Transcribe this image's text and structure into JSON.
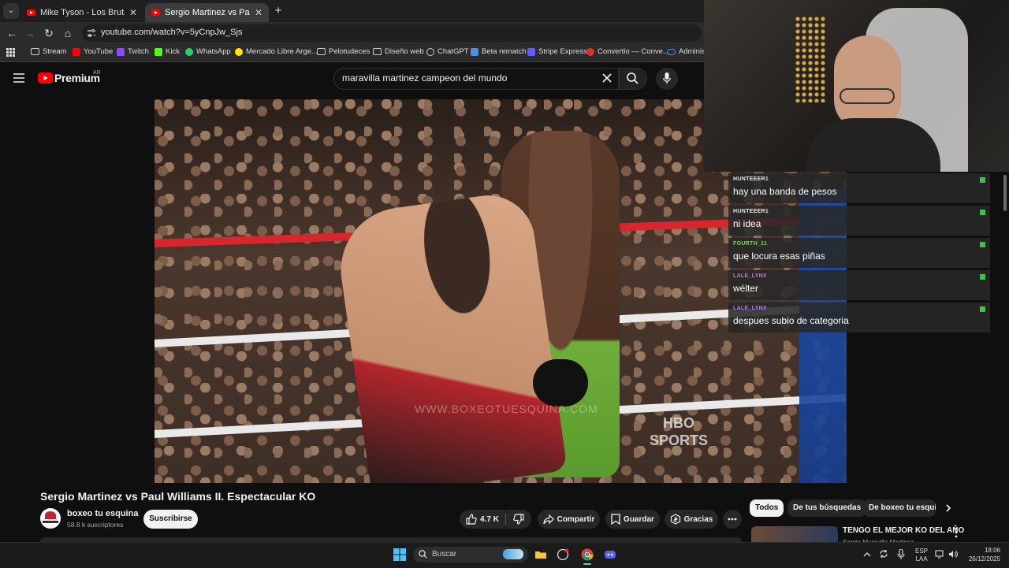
{
  "browser": {
    "tabs": [
      {
        "title": "Mike Tyson - Los Brutales Noca"
      },
      {
        "title": "Sergio Martinez vs Paul William"
      }
    ],
    "url": "youtube.com/watch?v=5yCnpJw_Sjs",
    "bookmarks": [
      "Stream",
      "YouTube",
      "Twitch",
      "Kick",
      "WhatsApp",
      "Mercado Libre Arge...",
      "Pelotudeces",
      "Diseño web",
      "ChatGPT",
      "Beta rematch",
      "Stripe Express",
      "Convertio — Conve...",
      "Administ"
    ]
  },
  "youtube": {
    "logo_text": "Premium",
    "logo_region": "AR",
    "search_query": "maravilla martinez campeon del mundo"
  },
  "video": {
    "watermark": "WWW.BOXEOTUESQUINA.COM",
    "network_logo": "HBO SPORTS",
    "title": "Sergio Martinez vs Paul Williams II. Espectacular KO",
    "channel": "boxeo tu esquina",
    "subscribers": "58.8 k suscriptores",
    "subscribe_label": "Suscribirse",
    "likes": "4.7 K",
    "share_label": "Compartir",
    "save_label": "Guardar",
    "thanks_label": "Gracias"
  },
  "chips": [
    "Todos",
    "De tus búsquedas",
    "De boxeo tu esquina"
  ],
  "recommendation": {
    "title": "TENGO EL MEJOR KO DEL AÑO",
    "channel": "Sergio Maravilla Martinez"
  },
  "chat": [
    {
      "user": "HUNTEEER1",
      "message": "hay una banda de pesos",
      "color": "#e8e8e8"
    },
    {
      "user": "HUNTEEER1",
      "message": "ni idea",
      "color": "#e8e8e8"
    },
    {
      "user": "FOURTH_11",
      "message": "que locura esas piñas",
      "color": "#7dd35a"
    },
    {
      "user": "LALE_LYNX",
      "message": "wélter",
      "color": "#b67be8"
    },
    {
      "user": "LALE_LYNX",
      "message": "despues subio de categoria",
      "color": "#b67be8"
    }
  ],
  "taskbar": {
    "search_placeholder": "Buscar",
    "language": "ESP",
    "layout": "LAA",
    "time": "18:06",
    "date": "26/12/2025"
  },
  "colors": {
    "youtube_red": "#ff0000",
    "background": "#0f0f0f",
    "chat_badge": "#2ecc40"
  }
}
